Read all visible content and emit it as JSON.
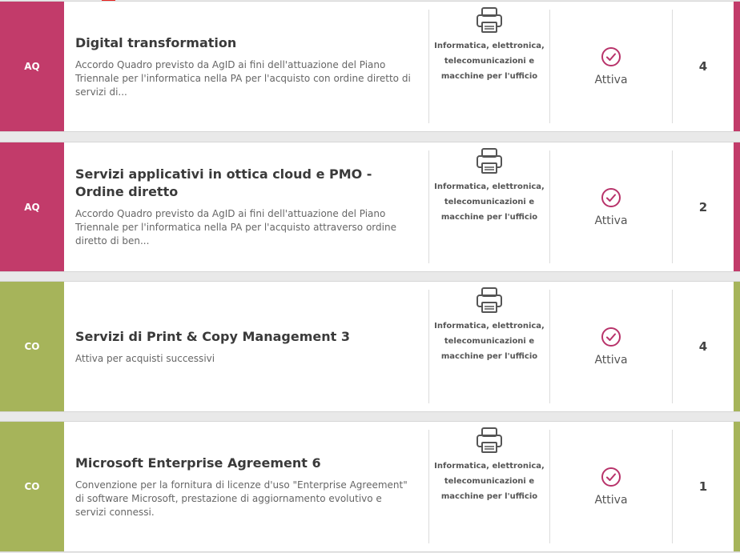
{
  "colors": {
    "aq": "#c23b6a",
    "co": "#a6b45a",
    "check": "#b8336a"
  },
  "items": [
    {
      "badge": "AQ",
      "kind": "aq",
      "title": "Digital transformation",
      "description": "Accordo Quadro previsto da AgID ai fini dell'attuazione del Piano Triennale per l'informatica nella PA per l'acquisto con ordine diretto di servizi di...",
      "category": "Informatica, elettronica, telecomunicazioni e macchine per l'ufficio",
      "category_icon": "printer-icon",
      "status": "Attiva",
      "status_icon": "check-circle-icon",
      "count": "4"
    },
    {
      "badge": "AQ",
      "kind": "aq",
      "title": "Servizi applicativi in ottica cloud e PMO - Ordine diretto",
      "description": "Accordo Quadro previsto da AgID ai fini dell'attuazione del Piano Triennale per l'informatica nella PA per l'acquisto attraverso ordine diretto di ben...",
      "category": "Informatica, elettronica, telecomunicazioni e macchine per l'ufficio",
      "category_icon": "printer-icon",
      "status": "Attiva",
      "status_icon": "check-circle-icon",
      "count": "2"
    },
    {
      "badge": "CO",
      "kind": "co",
      "title": "Servizi di Print & Copy Management 3",
      "description": "Attiva per acquisti successivi",
      "category": "Informatica, elettronica, telecomunicazioni e macchine per l'ufficio",
      "category_icon": "printer-icon",
      "status": "Attiva",
      "status_icon": "check-circle-icon",
      "count": "4"
    },
    {
      "badge": "CO",
      "kind": "co",
      "title": "Microsoft Enterprise Agreement 6",
      "description": "Convenzione per la fornitura di licenze d'uso \"Enterprise Agreement\" di software Microsoft, prestazione di aggiornamento evolutivo e servizi connessi.",
      "category": "Informatica, elettronica, telecomunicazioni e macchine per l'ufficio",
      "category_icon": "printer-icon",
      "status": "Attiva",
      "status_icon": "check-circle-icon",
      "count": "1"
    }
  ]
}
